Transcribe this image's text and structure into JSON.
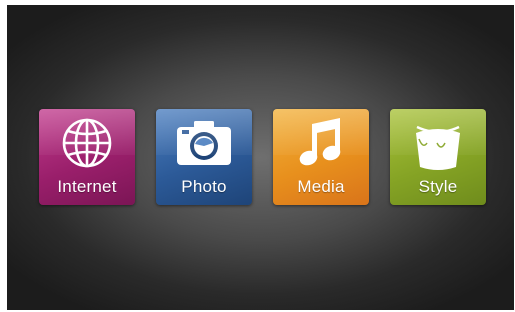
{
  "tiles": [
    {
      "label": "Internet",
      "icon": "globe-icon",
      "color": "#9a1f6b"
    },
    {
      "label": "Photo",
      "icon": "camera-icon",
      "color": "#2c5a98"
    },
    {
      "label": "Media",
      "icon": "music-note-icon",
      "color": "#e8901d"
    },
    {
      "label": "Style",
      "icon": "paint-bucket-icon",
      "color": "#86a425"
    }
  ]
}
